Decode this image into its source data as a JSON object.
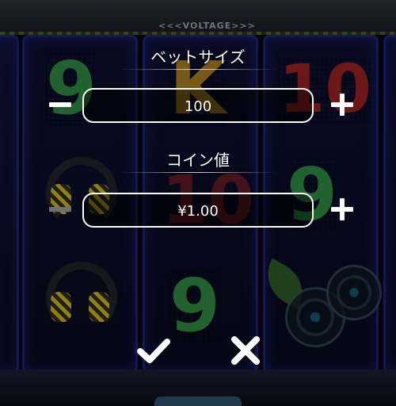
{
  "header": {
    "brand": "<<<VOLTAGE>>>"
  },
  "bet_panel": {
    "bet_size": {
      "label": "ベットサイズ",
      "value": "100",
      "decrease_enabled": true,
      "increase_enabled": true
    },
    "coin_value": {
      "label": "コイン値",
      "value": "¥1.00",
      "decrease_enabled": false,
      "increase_enabled": true
    },
    "confirm_icon": "check-icon",
    "cancel_icon": "close-icon"
  },
  "reel_symbols": {
    "col1_top": "9",
    "col2_top": "K",
    "col3_top": "10",
    "col2_mid": "10",
    "col3_mid": "9",
    "col2_bottom": "9"
  },
  "colors": {
    "reel_border": "#1c2277",
    "symbol_green": "#3bb34a",
    "symbol_gold": "#d9a21a",
    "symbol_red": "#c8281e",
    "button_white": "#ffffff",
    "button_disabled": "#6e7075"
  }
}
